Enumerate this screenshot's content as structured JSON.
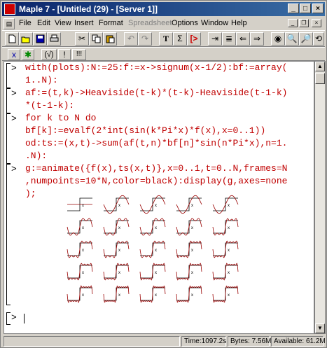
{
  "window": {
    "title": "Maple 7 - [Untitled (29) - [Server 1]]",
    "controls": {
      "minimize": "_",
      "maximize": "□",
      "close": "×"
    }
  },
  "menu": {
    "items": [
      "File",
      "Edit",
      "View",
      "Insert",
      "Format",
      "Spreadsheet",
      "Options",
      "Window",
      "Help"
    ],
    "disabled_index": 5
  },
  "toolbar1": {
    "icons": [
      "new-icon",
      "open-icon",
      "save-icon",
      "print-icon",
      "cut-icon",
      "copy-icon",
      "paste-icon",
      "undo-icon",
      "redo-icon",
      "text-icon",
      "sigma-icon",
      "prompt-icon",
      "section-icon",
      "unsection-icon",
      "back-icon",
      "forward-icon",
      "stop-icon",
      "zoom-in-icon",
      "zoom-out-icon",
      "restart-icon"
    ]
  },
  "toolbar2": {
    "labels": [
      "x",
      "✱",
      "(√)",
      "!",
      "!!!"
    ]
  },
  "worksheet": {
    "prompt": "[>",
    "group1": [
      "with(plots):N:=25:f:=x->signum(x-1/2):bf:=array(",
      "1..N):"
    ],
    "group2": [
      "af:=(t,k)->Heaviside(t-k)*(t-k)-Heaviside(t-1-k)",
      "*(t-1-k):"
    ],
    "group3": [
      "for k to N do",
      "bf[k]:=evalf(2*int(sin(k*Pi*x)*f(x),x=0..1))",
      "od:ts:=(x,t)->sum(af(t,n)*bf[n]*sin(n*Pi*x),n=1.",
      ".N):"
    ],
    "group4": [
      "g:=animate({f(x),ts(x,t)},x=0..1,t=0..N,frames=N",
      ",numpoints=10*N,color=black):display(g,axes=none",
      ");"
    ],
    "plot_caption": "x",
    "empty_prompt": "[>"
  },
  "status": {
    "time": "Time:1097.2s",
    "bytes": "Bytes: 7.56M",
    "available": "Available: 61.2M"
  }
}
